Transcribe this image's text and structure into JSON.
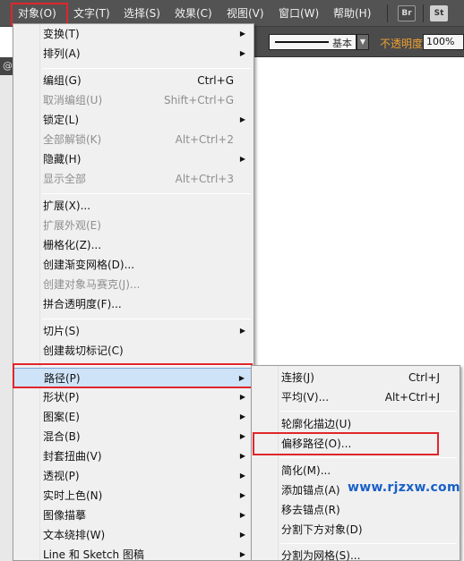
{
  "menubar": {
    "items": [
      "对象(O)",
      "文字(T)",
      "选择(S)",
      "效果(C)",
      "视图(V)",
      "窗口(W)",
      "帮助(H)"
    ],
    "app_icons": [
      "Br",
      "St"
    ]
  },
  "controlbar": {
    "stroke_style": "基本",
    "opacity_label": "不透明度：",
    "opacity_value": "100%"
  },
  "tab_symbol": "@",
  "object_menu": {
    "items": [
      {
        "label": "变换(T)",
        "shortcut": "",
        "submenu": true,
        "disabled": false
      },
      {
        "label": "排列(A)",
        "shortcut": "",
        "submenu": true,
        "disabled": false
      },
      {
        "label": "编组(G)",
        "shortcut": "Ctrl+G",
        "submenu": false,
        "disabled": false
      },
      {
        "label": "取消编组(U)",
        "shortcut": "Shift+Ctrl+G",
        "submenu": false,
        "disabled": true
      },
      {
        "label": "锁定(L)",
        "shortcut": "",
        "submenu": true,
        "disabled": false
      },
      {
        "label": "全部解锁(K)",
        "shortcut": "Alt+Ctrl+2",
        "submenu": false,
        "disabled": true
      },
      {
        "label": "隐藏(H)",
        "shortcut": "",
        "submenu": true,
        "disabled": false
      },
      {
        "label": "显示全部",
        "shortcut": "Alt+Ctrl+3",
        "submenu": false,
        "disabled": true
      },
      {
        "label": "扩展(X)...",
        "shortcut": "",
        "submenu": false,
        "disabled": false
      },
      {
        "label": "扩展外观(E)",
        "shortcut": "",
        "submenu": false,
        "disabled": true
      },
      {
        "label": "栅格化(Z)...",
        "shortcut": "",
        "submenu": false,
        "disabled": false
      },
      {
        "label": "创建渐变网格(D)...",
        "shortcut": "",
        "submenu": false,
        "disabled": false
      },
      {
        "label": "创建对象马赛克(J)...",
        "shortcut": "",
        "submenu": false,
        "disabled": true
      },
      {
        "label": "拼合透明度(F)...",
        "shortcut": "",
        "submenu": false,
        "disabled": false
      },
      {
        "label": "切片(S)",
        "shortcut": "",
        "submenu": true,
        "disabled": false
      },
      {
        "label": "创建裁切标记(C)",
        "shortcut": "",
        "submenu": false,
        "disabled": false
      },
      {
        "label": "路径(P)",
        "shortcut": "",
        "submenu": true,
        "disabled": false,
        "highlighted": true
      },
      {
        "label": "形状(P)",
        "shortcut": "",
        "submenu": true,
        "disabled": false
      },
      {
        "label": "图案(E)",
        "shortcut": "",
        "submenu": true,
        "disabled": false
      },
      {
        "label": "混合(B)",
        "shortcut": "",
        "submenu": true,
        "disabled": false
      },
      {
        "label": "封套扭曲(V)",
        "shortcut": "",
        "submenu": true,
        "disabled": false
      },
      {
        "label": "透视(P)",
        "shortcut": "",
        "submenu": true,
        "disabled": false
      },
      {
        "label": "实时上色(N)",
        "shortcut": "",
        "submenu": true,
        "disabled": false
      },
      {
        "label": "图像描摹",
        "shortcut": "",
        "submenu": true,
        "disabled": false
      },
      {
        "label": "文本绕排(W)",
        "shortcut": "",
        "submenu": true,
        "disabled": false
      },
      {
        "label": "Line 和 Sketch 图稿",
        "shortcut": "",
        "submenu": true,
        "disabled": false
      }
    ]
  },
  "path_submenu": {
    "items": [
      {
        "label": "连接(J)",
        "shortcut": "Ctrl+J"
      },
      {
        "label": "平均(V)...",
        "shortcut": "Alt+Ctrl+J"
      },
      {
        "label": "轮廓化描边(U)",
        "shortcut": ""
      },
      {
        "label": "偏移路径(O)...",
        "shortcut": "",
        "highlighted": true
      },
      {
        "label": "简化(M)...",
        "shortcut": ""
      },
      {
        "label": "添加锚点(A)",
        "shortcut": ""
      },
      {
        "label": "移去锚点(R)",
        "shortcut": ""
      },
      {
        "label": "分割下方对象(D)",
        "shortcut": ""
      },
      {
        "label": "分割为网格(S)...",
        "shortcut": ""
      }
    ]
  },
  "watermark": "www.rjzxw.com",
  "colors": {
    "menubar_bg": "#535353",
    "highlight_box": "#e0262b",
    "menu_bg": "#f0f0f0",
    "watermark": "#1a60c8"
  }
}
